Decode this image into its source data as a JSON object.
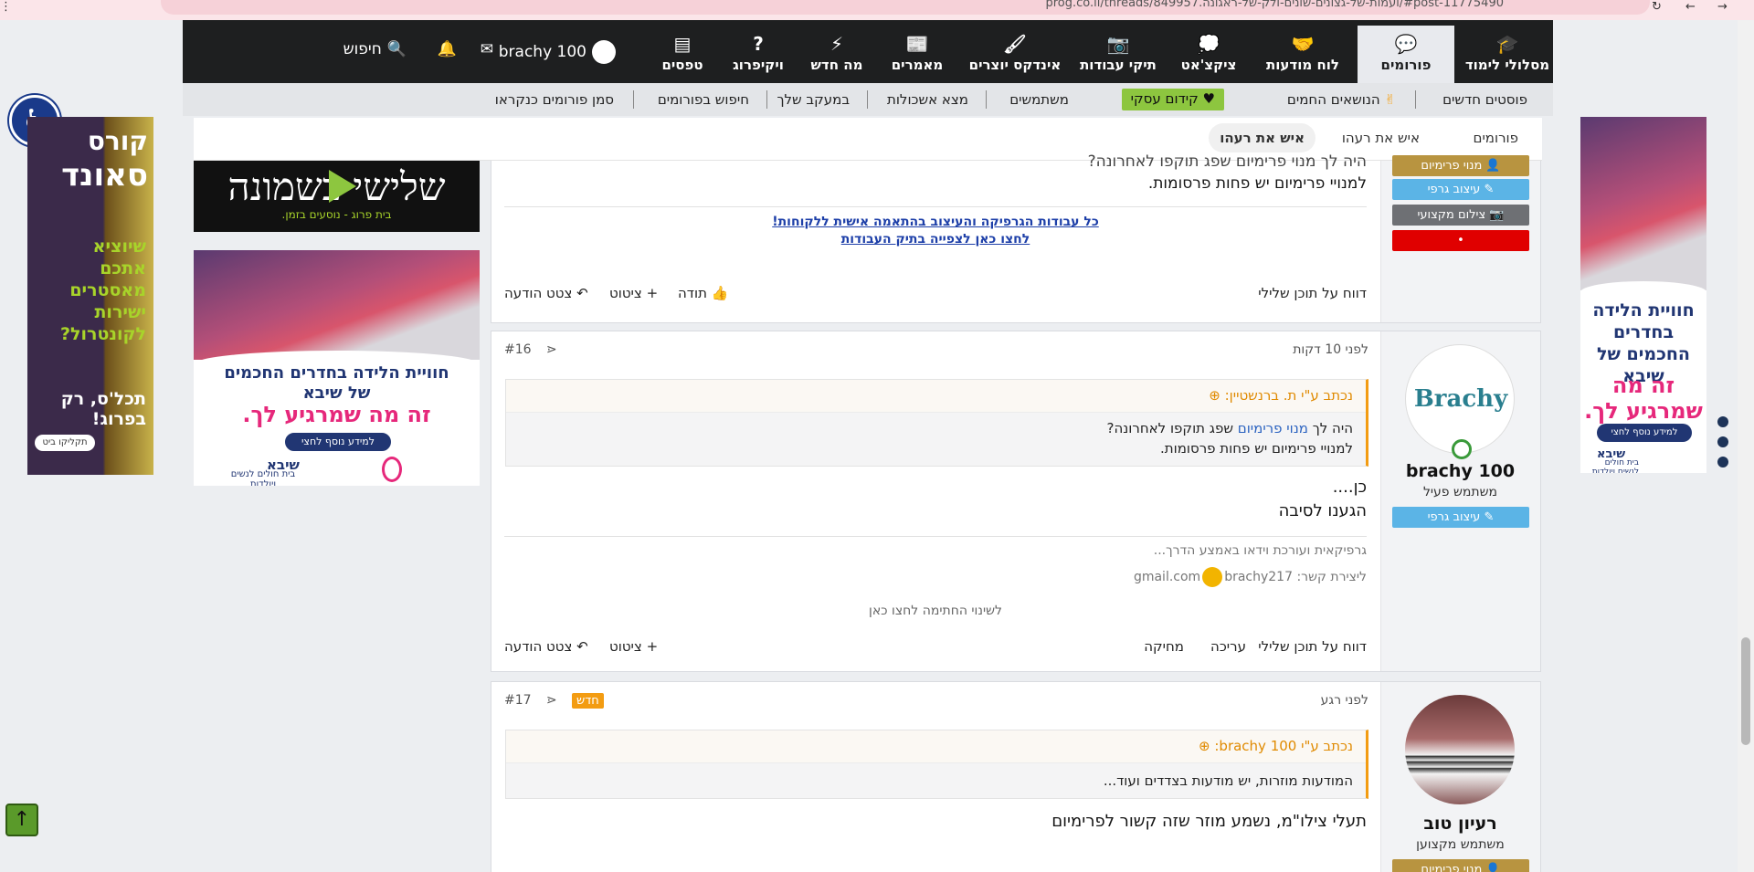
{
  "browser": {
    "url": "prog.co.il/threads/849957.ועמות-של-גצונים-שונים-ולק-של-ראגונה/#post-11775490"
  },
  "nav": {
    "tabs": [
      {
        "label": "מסלולי לימוד",
        "icon": "graduation-cap-icon",
        "glyph": "🎓"
      },
      {
        "label": "פורומים",
        "icon": "forums-icon",
        "glyph": "💬"
      },
      {
        "label": "לוח מודעות",
        "icon": "handshake-icon",
        "glyph": "🤝"
      },
      {
        "label": "ציקצ'אט",
        "icon": "chat-bubble-icon",
        "glyph": "💬"
      },
      {
        "label": "תיקי עבודות",
        "icon": "camera-icon",
        "glyph": "📷"
      },
      {
        "label": "אינדקס יוצרים",
        "icon": "brush-icon",
        "glyph": "🖌"
      },
      {
        "label": "מאמרים",
        "icon": "articles-icon",
        "glyph": "📰"
      },
      {
        "label": "מה חדש",
        "icon": "lightning-icon",
        "glyph": "⚡"
      },
      {
        "label": "ויקיפרוג",
        "icon": "question-icon",
        "glyph": "?"
      },
      {
        "label": "טפסים",
        "icon": "forms-icon",
        "glyph": "▤"
      }
    ],
    "username": "brachy 100",
    "search_label": "חיפוש"
  },
  "subnav": {
    "items": [
      "פוסטים חדשים",
      "הנושאים החמים",
      "קידום עסקי",
      "משתמשים",
      "מצא אשכולות",
      "במעקב שלך",
      "חיפוש בפורומים",
      "סמן פורומים כנקראו"
    ]
  },
  "breadcrumbs": [
    "פורומים",
    "איש את רעהו",
    "איש את רעהו"
  ],
  "post15": {
    "text1": "היה לך מנוי פרימיום שפג תוקפו לאחרונה?",
    "text2": "למנויי פרימיום יש פחות פרסומות.",
    "link1": "כל עבודות הגרפיקה והעיצוב בהתאמה אישית ללקוחות!",
    "link2": "לחצו כאן לצפייה בתיק העבודות",
    "badges": [
      "מנוי פרימיום",
      "עיצוב גרפי",
      "צילום מקצועי"
    ],
    "actions": {
      "report": "דווח על תוכן שלילי",
      "like": "תודה",
      "quote": "ציטוט",
      "reply": "צטט הודעה"
    }
  },
  "post16": {
    "time": "לפני 10 דקות",
    "number": "#16",
    "author": "brachy 100",
    "role": "משתמש פעיל",
    "badge": "עיצוב גרפי",
    "avatar_text": "Brachy",
    "quote_head": "נכתב ע\"י ת. ברנשטיין:",
    "quote_line1_a": "היה לך ",
    "quote_line1_link": "מנוי פרימיום",
    "quote_line1_b": " שפג תוקפו לאחרונה?",
    "quote_line2": "למנויי פרימיום יש פחות פרסומות.",
    "text1": "כן....",
    "text2": "הגענו לסיבה",
    "sig1": "גרפיקאית ועורכת וידאו באמצע הדרך...",
    "sig2_a": "ליצירת קשר: ",
    "sig2_b": "brachy217",
    "sig2_c": "gmail.com",
    "sig_change": "לשינוי החתימה לחצו כאן",
    "actions": {
      "report": "דווח על תוכן שלילי",
      "edit": "עריכה",
      "delete": "מחיקה",
      "quote": "ציטוט",
      "reply": "צטט הודעה"
    }
  },
  "post17": {
    "time": "לפני רגע",
    "number": "#17",
    "new_badge": "חדש",
    "author": "רעיון טוב",
    "role": "משתמש מקצוען",
    "badge": "מנוי פרימיום",
    "quote_head": "נכתב ע\"י brachy 100:",
    "quote_line1": "המודעות מוזרות, יש מודעות בצדדים ועוד...",
    "text1": "תעלי צילו\"מ, נשמע מוזר שזה קשור לפרימיום"
  },
  "ads": {
    "left_course_a": "קורס",
    "left_course_b": "סאונד",
    "left_course_c": "שיוציא אתכם מאסטרים ישירות לקונטרול?",
    "left_course_d": "תכל'ס, רק בפרוג!",
    "left_course_btn": "תקליקו ביט",
    "banner_top_a": "שלישי בשמונה",
    "banner_top_b": "בית פרוג - נוסעים בזמן.",
    "sheba_a": "חוויית הלידה בחדרים החכמים של שיבא",
    "sheba_b": "זה מה שמרגיע לך.",
    "sheba_btn": "למידע נוסף לחצי כאן>>",
    "sheba_c": "שיבא",
    "sheba_d": "בית חולים לנשים ויולדות"
  }
}
